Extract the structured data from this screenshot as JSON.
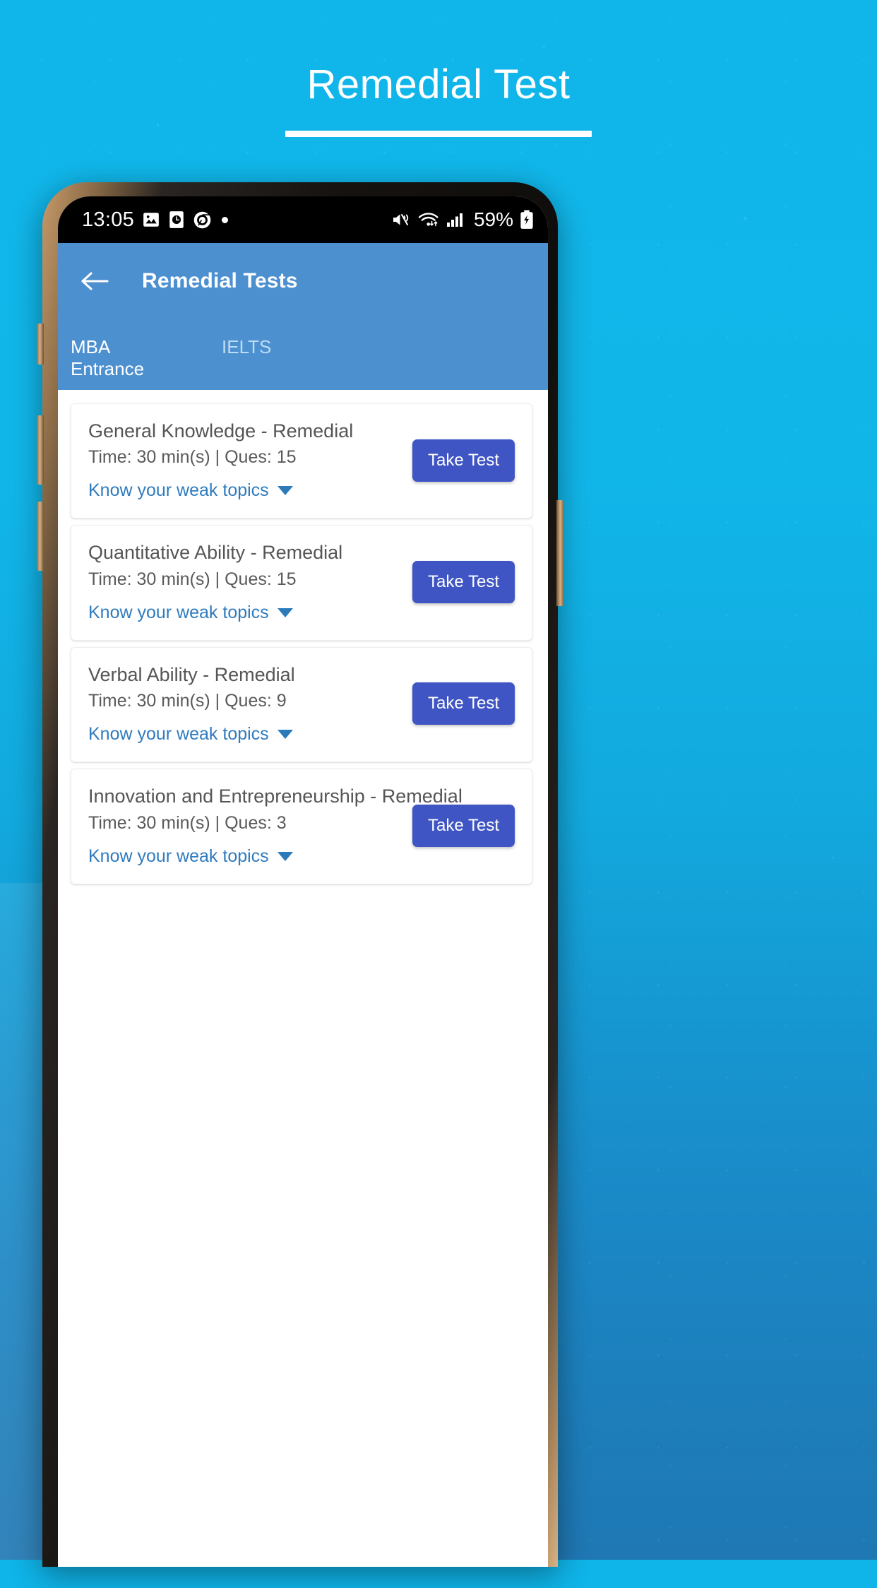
{
  "promo": {
    "title": "Remedial Test",
    "accent_color": "#0fb4e8",
    "underline_color": "#ffffff"
  },
  "status_bar": {
    "time": "13:05",
    "left_icons": [
      "image-icon",
      "clock-icon",
      "chrome-icon",
      "dot-icon"
    ],
    "right_icons": [
      "mute-vibrate-icon",
      "wifi-icon",
      "signal-bars-icon"
    ],
    "battery_percent": "59%",
    "battery_state": "charging"
  },
  "app_bar": {
    "back_icon": "back-arrow-icon",
    "title": "Remedial Tests",
    "background_color": "#4d90d0"
  },
  "tabs": {
    "items": [
      {
        "label": "MBA Entrance",
        "active": true
      },
      {
        "label": "IELTS",
        "active": false
      }
    ]
  },
  "list": {
    "weak_topics_label": "Know your weak topics",
    "take_test_label": "Take Test",
    "button_color": "#4055c4",
    "link_color": "#2f7bbf",
    "cards": [
      {
        "title": "General Knowledge - Remedial",
        "meta": "Time: 30 min(s) | Ques: 15",
        "time": "30 min(s)",
        "questions": "15"
      },
      {
        "title": "Quantitative Ability - Remedial",
        "meta": "Time: 30 min(s) | Ques: 15",
        "time": "30 min(s)",
        "questions": "15"
      },
      {
        "title": "Verbal Ability - Remedial",
        "meta": "Time: 30 min(s) | Ques: 9",
        "time": "30 min(s)",
        "questions": "9"
      },
      {
        "title": "Innovation and Entrepreneurship - Remedial",
        "meta": "Time: 30 min(s) | Ques: 3",
        "time": "30 min(s)",
        "questions": "3"
      }
    ]
  }
}
